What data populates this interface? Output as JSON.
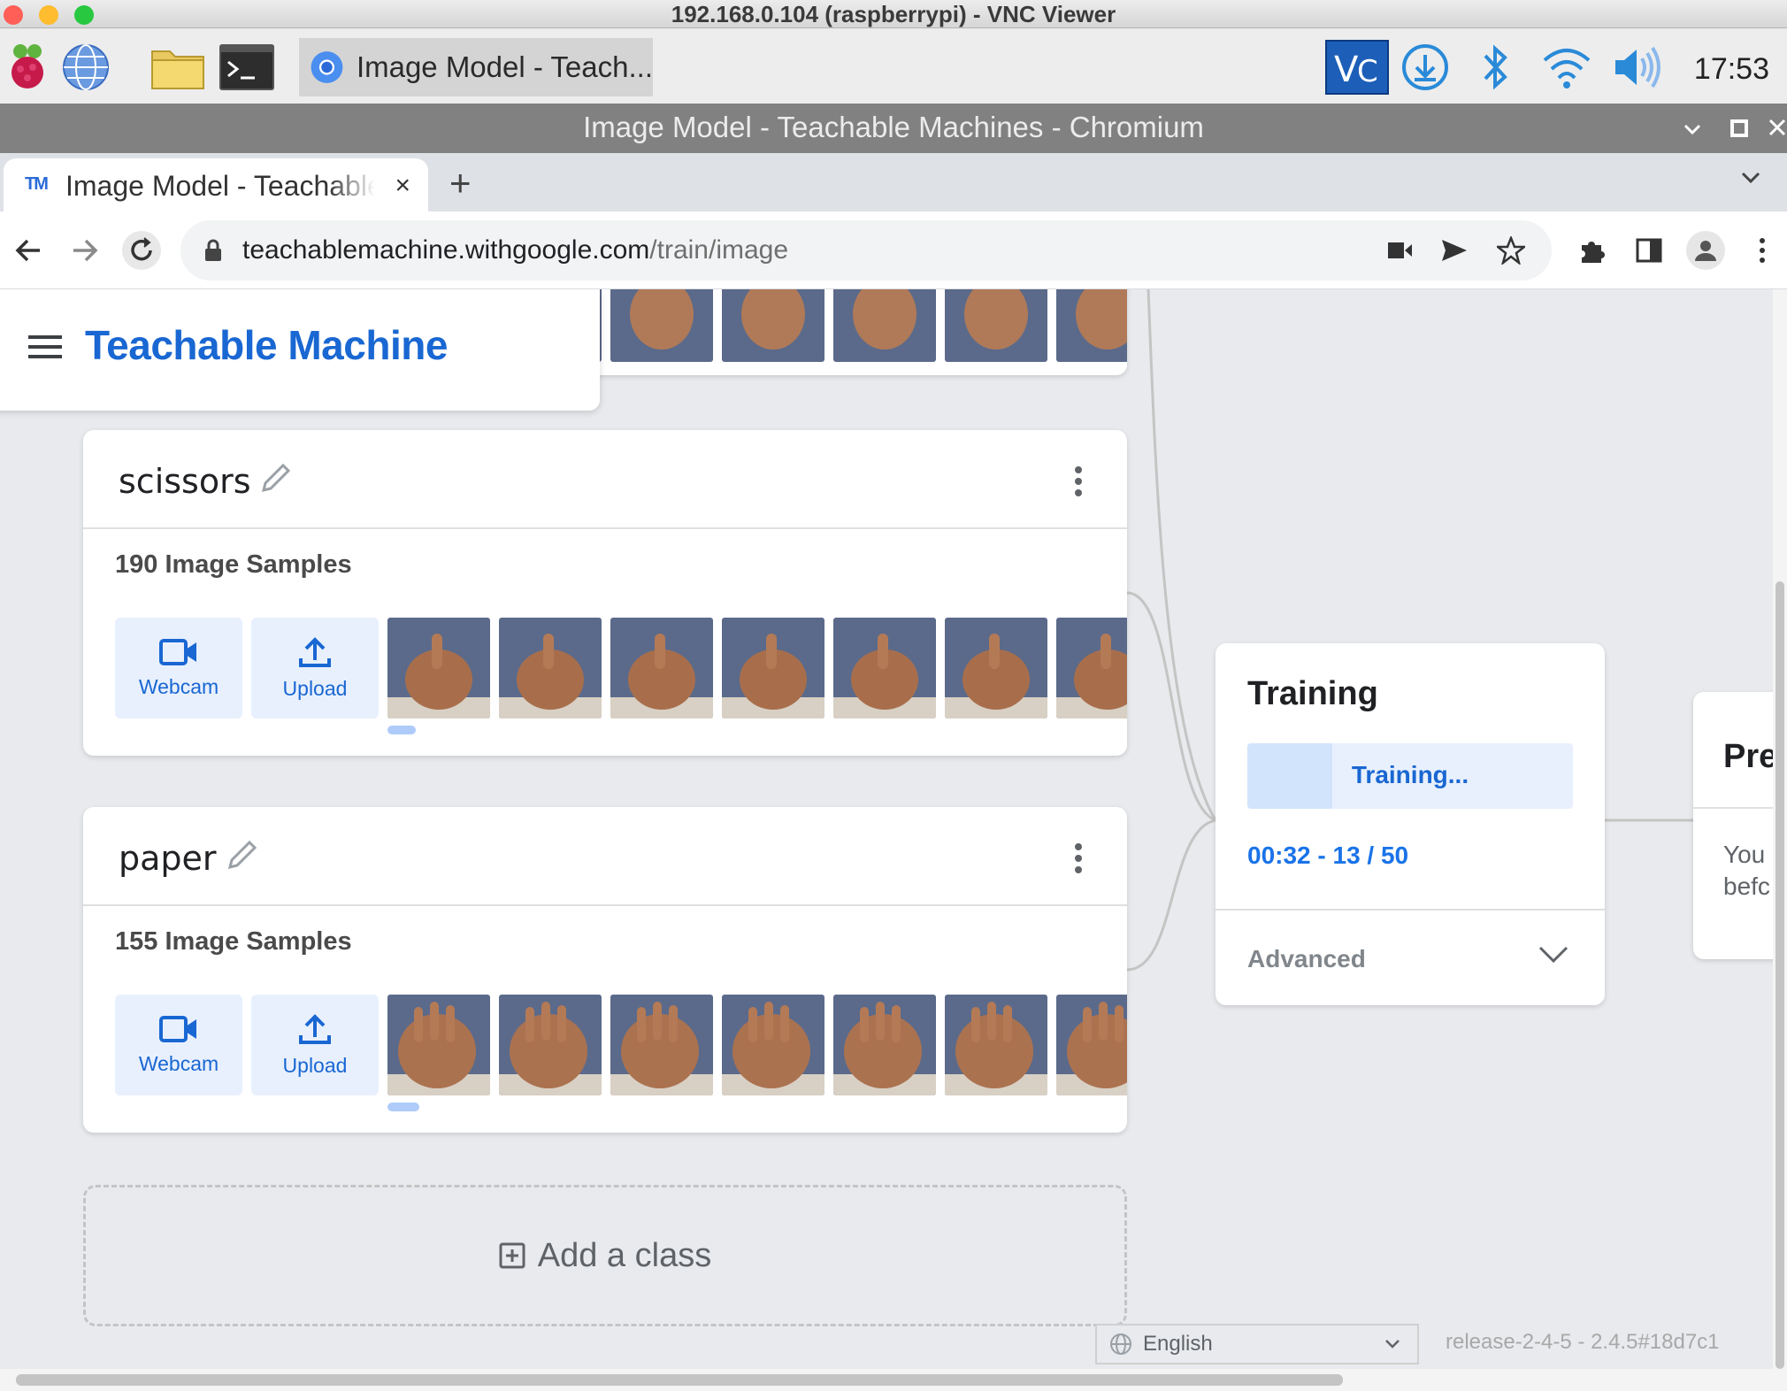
{
  "vnc": {
    "window_title": "192.168.0.104 (raspberrypi) - VNC Viewer"
  },
  "taskbar": {
    "task_label": "Image Model - Teach...",
    "clock": "17:53"
  },
  "browser": {
    "window_title": "Image Model - Teachable Machines - Chromium",
    "tab_title": "Image Model - Teachable Machines",
    "tab_close": "×",
    "new_tab": "+",
    "url_host": "teachablemachine.withgoogle.com",
    "url_path": "/train/image"
  },
  "app": {
    "title": "Teachable Machine"
  },
  "classes": [
    {
      "name": "scissors",
      "samples": "190 Image Samples",
      "webcam_label": "Webcam",
      "upload_label": "Upload"
    },
    {
      "name": "paper",
      "samples": "155 Image Samples",
      "webcam_label": "Webcam",
      "upload_label": "Upload"
    }
  ],
  "add_class": {
    "label": "Add a class"
  },
  "training": {
    "title": "Training",
    "status": "Training...",
    "progress_text": "00:32 - 13 / 50",
    "progress_fraction": 0.26,
    "advanced_label": "Advanced"
  },
  "preview": {
    "title": "Pre",
    "text_line1": "You",
    "text_line2": "befc"
  },
  "footer": {
    "language": "English",
    "release": "release-2-4-5 - 2.4.5#18d7c1"
  },
  "colors": {
    "accent": "#1967d2",
    "accent_light": "#e8f0fe"
  }
}
